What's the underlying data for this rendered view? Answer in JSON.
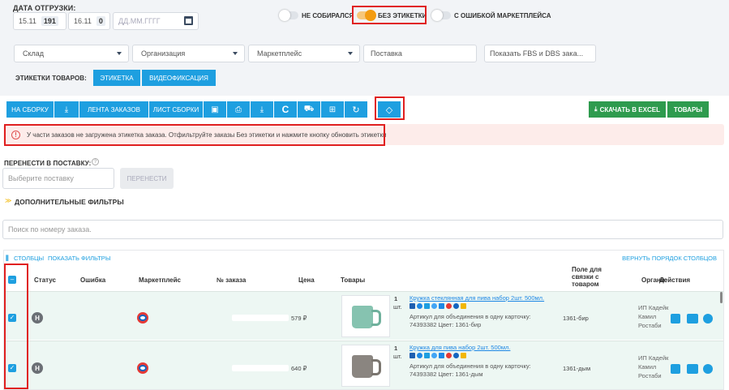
{
  "header": {
    "date_label": "ДАТА ОТГРУЗКИ:",
    "date_chips": [
      {
        "date": "15.11",
        "count": "191"
      },
      {
        "date": "16.11",
        "count": "0"
      }
    ],
    "date_placeholder": "ДД.ММ.ГГГГ"
  },
  "toggles": [
    {
      "label": "НЕ СОБИРАЛСЯ",
      "on": false
    },
    {
      "label": "БЕЗ ЭТИКЕТКИ",
      "on": true
    },
    {
      "label": "С ОШИБКОЙ МАРКЕТПЛЕЙСА",
      "on": false
    }
  ],
  "filters": {
    "warehouse": "Склад",
    "organization": "Организация",
    "marketplace": "Маркетплейс",
    "supply": "Поставка",
    "show_fbs": "Показать FBS и DBS зака..."
  },
  "labels_row": {
    "label": "ЭТИКЕТКИ ТОВАРОВ:",
    "btn_label": "ЭТИКЕТКА",
    "btn_video": "ВИДЕОФИКСАЦИЯ"
  },
  "toolbar": {
    "to_assembly": "НА СБОРКУ",
    "orders_tape": "ЛЕНТА ЗАКАЗОВ",
    "assembly_sheet": "ЛИСТ СБОРКИ",
    "download_excel": "СКАЧАТЬ В EXCEL",
    "goods": "ТОВАРЫ"
  },
  "alert": {
    "text": "У части заказов не загружена этикетка заказа. Отфильтруйте заказы Без этикетки и нажмите кнопку обновить этикетки"
  },
  "transfer": {
    "label": "ПЕРЕНЕСТИ В ПОСТАВКУ:",
    "help": "?",
    "placeholder": "Выберите поставку",
    "button": "ПЕРЕНЕСТИ"
  },
  "extra_filters": "ДОПОЛНИТЕЛЬНЫЕ ФИЛЬТРЫ",
  "search_placeholder": "Поиск по номеру заказа.",
  "table": {
    "columns_link": "СТОЛБЦЫ",
    "show_filters": "ПОКАЗАТЬ ФИЛЬТРЫ",
    "reset_order": "ВЕРНУТЬ ПОРЯДОК СТОЛБЦОВ",
    "headers": {
      "status": "Статус",
      "error": "Ошибка",
      "marketplace": "Маркетплейс",
      "order_no": "№ заказа",
      "price": "Цена",
      "goods": "Товары",
      "link_field_1": "Поле для",
      "link_field_2": "связки с",
      "link_field_3": "товаром",
      "org": "Органи:",
      "actions": "Действия"
    },
    "rows": [
      {
        "status": "Н",
        "price": "579 ₽",
        "qty": "1",
        "unit": "шт.",
        "product_link": "Кружка стеклянная для пива набор 2шт. 500мл.",
        "article_1": "Артикул для объединения в одну карточку:",
        "article_2": "74393382 Цвет: 1361-бир",
        "link_value": "1361-бир",
        "org_1": "ИП Кадейк",
        "org_2": "Камил",
        "org_3": "Ростаби",
        "mug_color": "green"
      },
      {
        "status": "Н",
        "price": "640 ₽",
        "qty": "1",
        "unit": "шт.",
        "product_link": "Кружка для пива набор 2шт. 500мл.",
        "article_1": "Артикул для объединения в одну карточку:",
        "article_2": "74393382 Цвет: 1361-дым",
        "link_value": "1361-дым",
        "org_1": "ИП Кадейк",
        "org_2": "Камил",
        "org_3": "Ростаби",
        "mug_color": "smoke"
      }
    ]
  },
  "colors": {
    "accent_blue": "#1e9fe0",
    "green": "#2e9b4e",
    "highlight_red": "#e02020",
    "toggle_orange": "#f39c12"
  }
}
